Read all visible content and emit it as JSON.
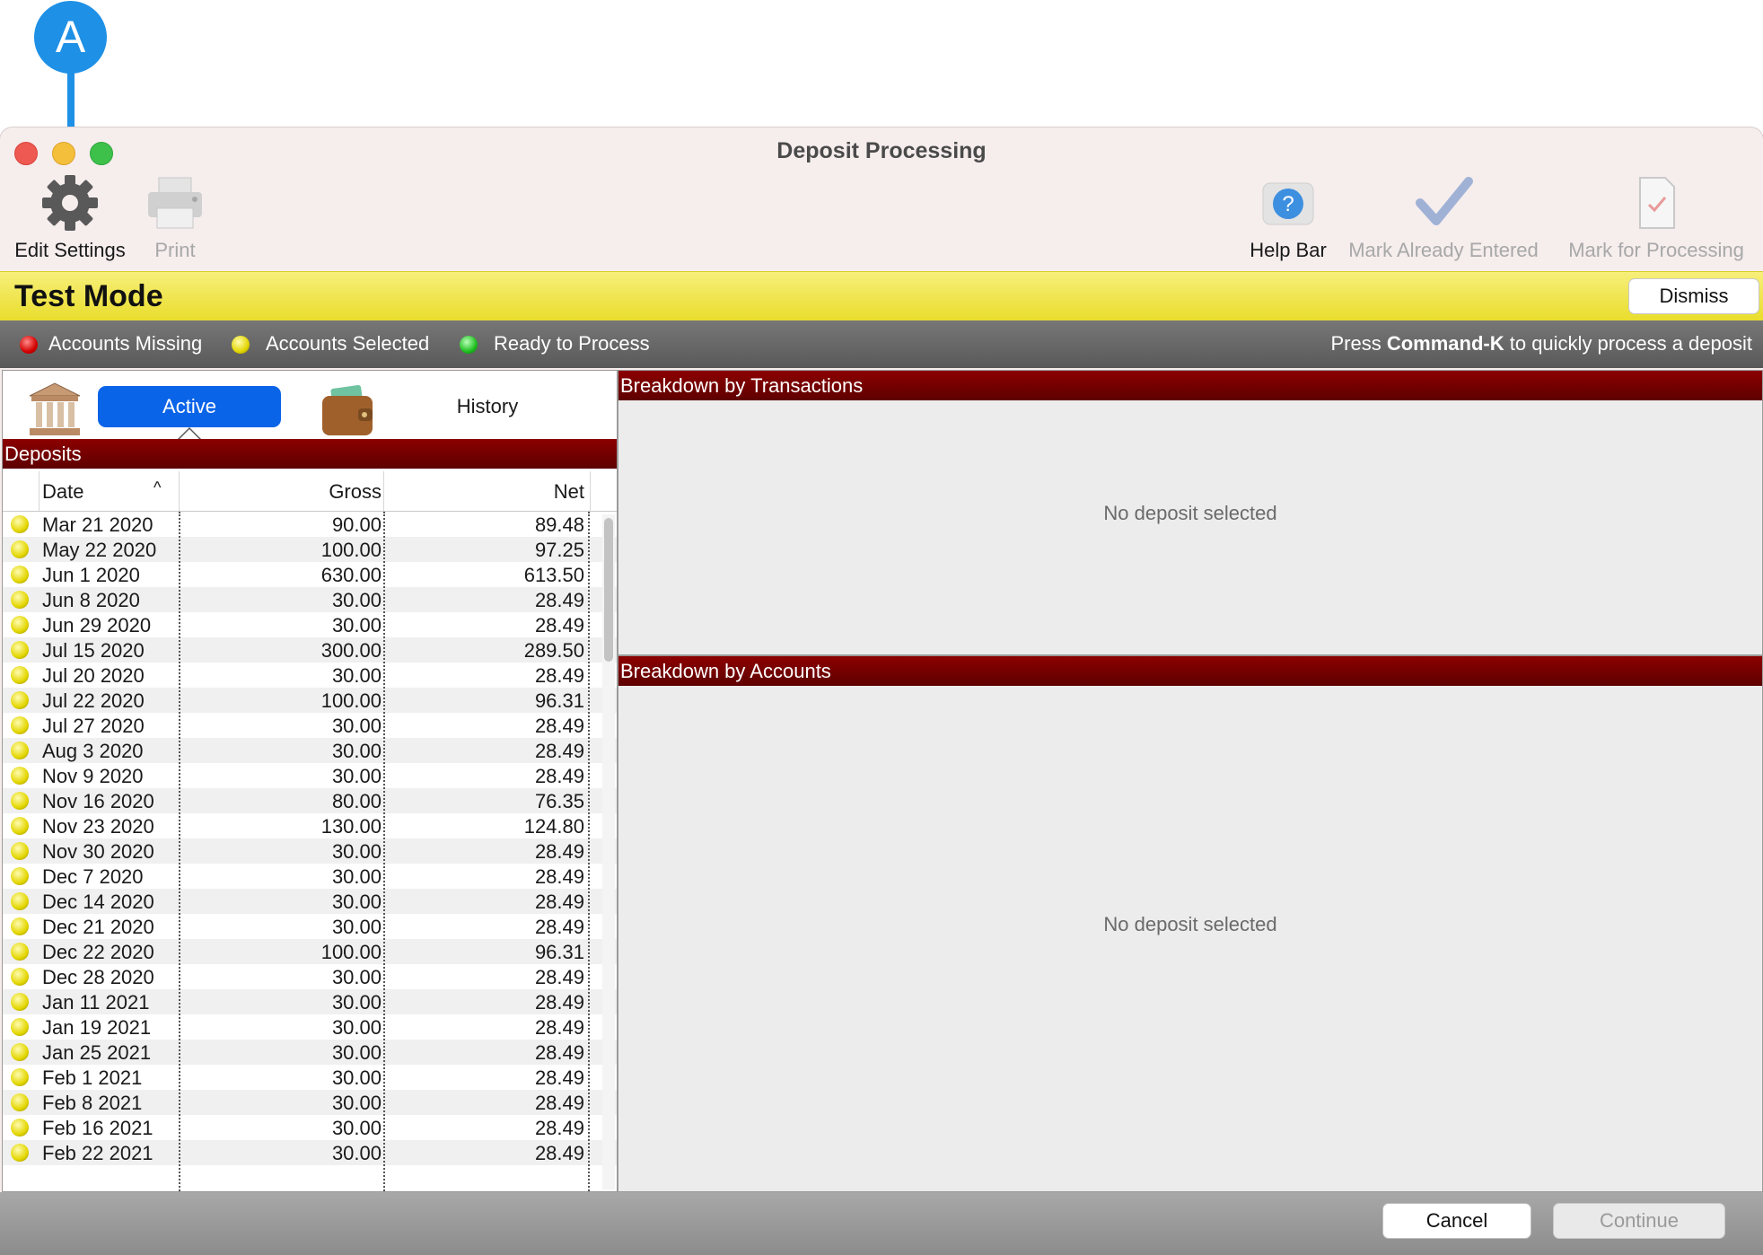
{
  "annotation": {
    "label": "A"
  },
  "window": {
    "title": "Deposit Processing"
  },
  "toolbar": {
    "edit_settings": "Edit Settings",
    "print": "Print",
    "help_bar": "Help Bar",
    "mark_already_entered": "Mark Already Entered",
    "mark_for_processing": "Mark for Processing"
  },
  "banner": {
    "title": "Test Mode",
    "dismiss": "Dismiss"
  },
  "legend": {
    "missing": "Accounts Missing",
    "selected": "Accounts Selected",
    "ready": "Ready to Process",
    "hint_prefix": "Press ",
    "hint_key": "Command-K",
    "hint_suffix": " to quickly process a deposit",
    "colors": {
      "missing": "#d40000",
      "selected": "#e3d600",
      "ready": "#1fbf1f"
    }
  },
  "tabs": {
    "active": "Active",
    "history": "History"
  },
  "deposits": {
    "header": "Deposits",
    "columns": {
      "date": "Date",
      "gross": "Gross",
      "net": "Net"
    },
    "sort": "ascending",
    "rows": [
      {
        "status": "accounts-selected",
        "date": "Mar 21 2020",
        "gross": "90.00",
        "net": "89.48"
      },
      {
        "status": "accounts-selected",
        "date": "May 22 2020",
        "gross": "100.00",
        "net": "97.25"
      },
      {
        "status": "accounts-selected",
        "date": "Jun 1 2020",
        "gross": "630.00",
        "net": "613.50"
      },
      {
        "status": "accounts-selected",
        "date": "Jun 8 2020",
        "gross": "30.00",
        "net": "28.49"
      },
      {
        "status": "accounts-selected",
        "date": "Jun 29 2020",
        "gross": "30.00",
        "net": "28.49"
      },
      {
        "status": "accounts-selected",
        "date": "Jul 15 2020",
        "gross": "300.00",
        "net": "289.50"
      },
      {
        "status": "accounts-selected",
        "date": "Jul 20 2020",
        "gross": "30.00",
        "net": "28.49"
      },
      {
        "status": "accounts-selected",
        "date": "Jul 22 2020",
        "gross": "100.00",
        "net": "96.31"
      },
      {
        "status": "accounts-selected",
        "date": "Jul 27 2020",
        "gross": "30.00",
        "net": "28.49"
      },
      {
        "status": "accounts-selected",
        "date": "Aug 3 2020",
        "gross": "30.00",
        "net": "28.49"
      },
      {
        "status": "accounts-selected",
        "date": "Nov 9 2020",
        "gross": "30.00",
        "net": "28.49"
      },
      {
        "status": "accounts-selected",
        "date": "Nov 16 2020",
        "gross": "80.00",
        "net": "76.35"
      },
      {
        "status": "accounts-selected",
        "date": "Nov 23 2020",
        "gross": "130.00",
        "net": "124.80"
      },
      {
        "status": "accounts-selected",
        "date": "Nov 30 2020",
        "gross": "30.00",
        "net": "28.49"
      },
      {
        "status": "accounts-selected",
        "date": "Dec 7 2020",
        "gross": "30.00",
        "net": "28.49"
      },
      {
        "status": "accounts-selected",
        "date": "Dec 14 2020",
        "gross": "30.00",
        "net": "28.49"
      },
      {
        "status": "accounts-selected",
        "date": "Dec 21 2020",
        "gross": "30.00",
        "net": "28.49"
      },
      {
        "status": "accounts-selected",
        "date": "Dec 22 2020",
        "gross": "100.00",
        "net": "96.31"
      },
      {
        "status": "accounts-selected",
        "date": "Dec 28 2020",
        "gross": "30.00",
        "net": "28.49"
      },
      {
        "status": "accounts-selected",
        "date": "Jan 11 2021",
        "gross": "30.00",
        "net": "28.49"
      },
      {
        "status": "accounts-selected",
        "date": "Jan 19 2021",
        "gross": "30.00",
        "net": "28.49"
      },
      {
        "status": "accounts-selected",
        "date": "Jan 25 2021",
        "gross": "30.00",
        "net": "28.49"
      },
      {
        "status": "accounts-selected",
        "date": "Feb 1 2021",
        "gross": "30.00",
        "net": "28.49"
      },
      {
        "status": "accounts-selected",
        "date": "Feb 8 2021",
        "gross": "30.00",
        "net": "28.49"
      },
      {
        "status": "accounts-selected",
        "date": "Feb 16 2021",
        "gross": "30.00",
        "net": "28.49"
      },
      {
        "status": "accounts-selected",
        "date": "Feb 22 2021",
        "gross": "30.00",
        "net": "28.49"
      }
    ]
  },
  "breakdown_transactions": {
    "header": "Breakdown by Transactions",
    "empty": "No deposit selected"
  },
  "breakdown_accounts": {
    "header": "Breakdown by Accounts",
    "empty": "No deposit selected"
  },
  "footer": {
    "cancel": "Cancel",
    "continue": "Continue"
  },
  "icons": [
    "gear-icon",
    "printer-icon",
    "help-icon",
    "checkmark-icon",
    "document-check-icon",
    "bank-icon",
    "wallet-icon",
    "sort-ascending-icon"
  ]
}
